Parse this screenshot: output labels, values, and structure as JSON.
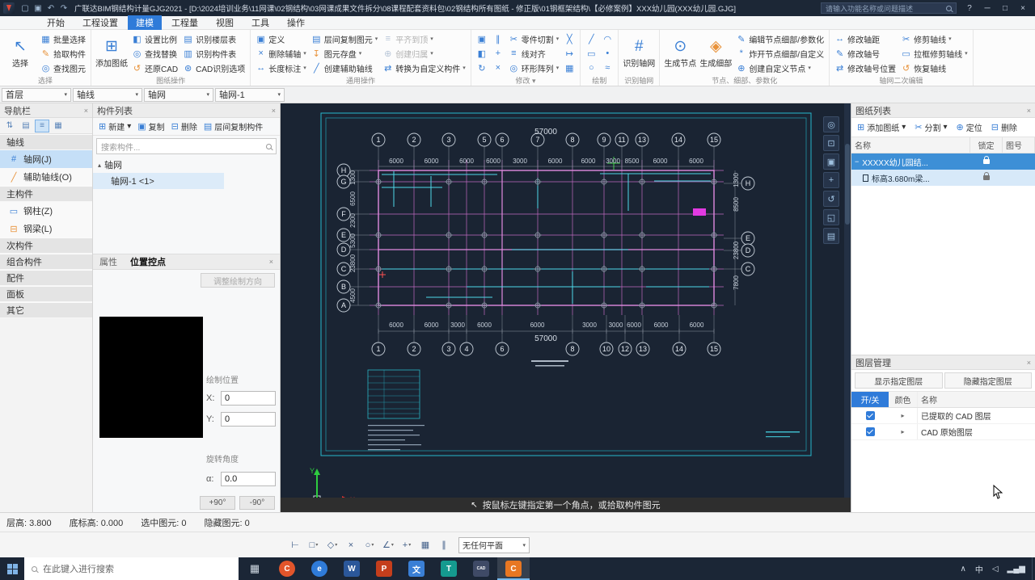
{
  "titlebar": {
    "title": "广联达BIM钢结构计量GJG2021 - [D:\\2024培训业务\\11网课\\02钢结构\\03网课成果文件拆分\\08课程配套资料包\\02钢结构所有图纸 - 修正版\\01钢框架结构\\【必修案例】XXX幼儿园(XXX幼儿园.GJG]",
    "search_placeholder": "请输入功能名称或问题描述",
    "quick_icons": [
      {
        "n": "new-file-icon",
        "g": "▢"
      },
      {
        "n": "save-icon",
        "g": "▣"
      },
      {
        "n": "undo-icon",
        "g": "↶"
      },
      {
        "n": "redo-icon",
        "g": "↷"
      }
    ]
  },
  "menubar": {
    "items": [
      {
        "label": "开始"
      },
      {
        "label": "工程设置"
      },
      {
        "label": "建模",
        "active": true
      },
      {
        "label": "工程量"
      },
      {
        "label": "视图"
      },
      {
        "label": "工具"
      },
      {
        "label": "操作"
      }
    ]
  },
  "ribbon": {
    "groups": [
      {
        "n": "select",
        "label": "选择",
        "bigs": [
          {
            "n": "select-tool",
            "g": "↖",
            "label": "选择"
          }
        ],
        "cols": [
          [
            {
              "n": "batch-select",
              "g": "▦",
              "label": "批量选择"
            },
            {
              "n": "pick-component",
              "g": "✎",
              "label": "拾取构件",
              "c": "o"
            },
            {
              "n": "find-element",
              "g": "◎",
              "label": "查找图元"
            }
          ]
        ]
      },
      {
        "n": "drawing-ops",
        "label": "图纸操作",
        "bigs": [
          {
            "n": "add-drawing",
            "g": "⊞",
            "label": "添加图纸"
          }
        ],
        "cols": [
          [
            {
              "n": "set-scale",
              "g": "◧",
              "label": "设置比例"
            },
            {
              "n": "find-replace",
              "g": "◎",
              "label": "查找替换"
            },
            {
              "n": "restore-cad",
              "g": "↺",
              "label": "还原CAD",
              "c": "o"
            }
          ],
          [
            {
              "n": "identify-floor-table",
              "g": "▤",
              "label": "识别楼层表"
            },
            {
              "n": "identify-component-table",
              "g": "▥",
              "label": "识别构件表"
            },
            {
              "n": "cad-identify-options",
              "g": "⊛",
              "label": "CAD识别选项"
            }
          ]
        ]
      },
      {
        "n": "general-ops",
        "label": "通用操作",
        "cols": [
          [
            {
              "n": "define",
              "g": "▣",
              "label": "定义"
            },
            {
              "n": "delete-aux-axis",
              "g": "×",
              "label": "删除辅轴",
              "arrow": true
            },
            {
              "n": "length-annotation",
              "g": "↔",
              "label": "长度标注",
              "arrow": true
            }
          ],
          [
            {
              "n": "copy-between-floors",
              "g": "▤",
              "label": "层间复制图元",
              "arrow": true
            },
            {
              "n": "save-element",
              "g": "↧",
              "label": "图元存盘",
              "arrow": true,
              "c": "o"
            },
            {
              "n": "create-aux-axis",
              "g": "╱",
              "label": "创建辅助轴线"
            }
          ],
          [
            {
              "n": "align-to-top",
              "g": "≡",
              "label": "平齐到顶",
              "arrow": true,
              "disabled": true
            },
            {
              "n": "create-attribution",
              "g": "⊕",
              "label": "创建归属",
              "arrow": true,
              "disabled": true
            },
            {
              "n": "convert-to-custom",
              "g": "⇄",
              "label": "转换为自定义构件",
              "arrow": true
            }
          ]
        ]
      },
      {
        "n": "modify",
        "label": "修改",
        "labelArrow": true,
        "cols": [
          [
            {
              "n": "copy-icon",
              "g": "▣"
            },
            {
              "n": "mirror-icon",
              "g": "◧"
            },
            {
              "n": "rotate-icon",
              "g": "↻"
            }
          ],
          [
            {
              "n": "offset-icon",
              "g": "∥"
            },
            {
              "n": "move-icon",
              "g": "+"
            },
            {
              "n": "delete-icon",
              "g": "×"
            }
          ],
          [
            {
              "n": "part-cut",
              "g": "✂",
              "label": "零件切割",
              "arrow": true
            },
            {
              "n": "line-align",
              "g": "≡",
              "label": "线对齐"
            },
            {
              "n": "circular-array",
              "g": "◎",
              "label": "环形阵列",
              "arrow": true
            }
          ],
          [
            {
              "n": "trim-icon",
              "g": "╳"
            },
            {
              "n": "extend-icon",
              "g": "↦"
            },
            {
              "n": "array-icon",
              "g": "▦"
            }
          ]
        ]
      },
      {
        "n": "draw",
        "label": "绘制",
        "cols": [
          [
            {
              "n": "line-draw-icon",
              "g": "╱"
            },
            {
              "n": "rect-draw-icon",
              "g": "▭"
            },
            {
              "n": "circle-draw-icon",
              "g": "○"
            }
          ],
          [
            {
              "n": "arc-draw-icon",
              "g": "◠"
            },
            {
              "n": "point-draw-icon",
              "g": "•"
            },
            {
              "n": "curve-draw-icon",
              "g": "≈"
            }
          ]
        ]
      },
      {
        "n": "identify-grid",
        "label": "识别轴网",
        "bigs": [
          {
            "n": "identify-grid",
            "g": "#",
            "label": "识别轴网"
          }
        ]
      },
      {
        "n": "node-detail-param",
        "label": "节点、细部、参数化",
        "bigs": [
          {
            "n": "generate-node",
            "g": "⊙",
            "label": "生成节点"
          },
          {
            "n": "generate-detail",
            "g": "◈",
            "label": "生成细部",
            "c": "o"
          }
        ],
        "cols": [
          [
            {
              "n": "edit-node-detail",
              "g": "✎",
              "label": "编辑节点细部/参数化"
            },
            {
              "n": "explode-node-detail",
              "g": "*",
              "label": "炸开节点细部/自定义"
            },
            {
              "n": "create-custom-node",
              "g": "⊕",
              "label": "创建自定义节点",
              "arrow": true
            }
          ]
        ]
      },
      {
        "n": "grid-edit",
        "label": "轴网二次编辑",
        "cols": [
          [
            {
              "n": "modify-axis-spacing",
              "g": "↔",
              "label": "修改轴距"
            },
            {
              "n": "modify-axis-number",
              "g": "✎",
              "label": "修改轴号"
            },
            {
              "n": "modify-axis-number-pos",
              "g": "⇄",
              "label": "修改轴号位置"
            }
          ],
          [
            {
              "n": "trim-axis",
              "g": "✂",
              "label": "修剪轴线",
              "arrow": true
            },
            {
              "n": "box-trim-axis",
              "g": "▭",
              "label": "拉框修剪轴线",
              "arrow": true
            },
            {
              "n": "restore-axis",
              "g": "↺",
              "label": "恢复轴线",
              "c": "o"
            }
          ]
        ]
      }
    ]
  },
  "context_toolbar": {
    "dropdowns": [
      {
        "n": "floor-select",
        "value": "首层"
      },
      {
        "n": "element-category-select",
        "value": "轴线"
      },
      {
        "n": "component-type-select",
        "value": "轴网"
      },
      {
        "n": "component-select",
        "value": "轴网-1"
      }
    ]
  },
  "nav": {
    "title": "导航栏",
    "tools": [
      {
        "n": "nav-collapse-icon",
        "g": "⇅"
      },
      {
        "n": "nav-grid-view-icon",
        "g": "▤"
      },
      {
        "n": "nav-list-view-icon",
        "g": "≡",
        "active": true
      },
      {
        "n": "nav-tile-view-icon",
        "g": "▦"
      }
    ],
    "items": [
      {
        "type": "header",
        "label": "轴线"
      },
      {
        "type": "item",
        "label": "轴网(J)",
        "g": "#",
        "selected": true
      },
      {
        "type": "item",
        "label": "辅助轴线(O)",
        "g": "╱",
        "c": "o"
      },
      {
        "type": "header",
        "label": "主构件"
      },
      {
        "type": "item",
        "label": "钢柱(Z)",
        "g": "▭"
      },
      {
        "type": "item",
        "label": "钢梁(L)",
        "g": "⊟",
        "c": "o"
      },
      {
        "type": "header",
        "label": "次构件"
      },
      {
        "type": "header",
        "label": "组合构件"
      },
      {
        "type": "header",
        "label": "配件"
      },
      {
        "type": "header",
        "label": "面板"
      },
      {
        "type": "header",
        "label": "其它"
      }
    ]
  },
  "component_panel": {
    "title": "构件列表",
    "toolbar": [
      {
        "n": "new-component",
        "g": "⊞",
        "label": "新建",
        "arrow": true
      },
      {
        "n": "copy-component",
        "g": "▣",
        "label": "复制"
      },
      {
        "n": "delete-component",
        "g": "⊟",
        "label": "删除"
      },
      {
        "n": "copy-between-floors-component",
        "g": "▤",
        "label": "层间复制构件"
      }
    ],
    "search_placeholder": "搜索构件...",
    "tree": {
      "group": "轴网",
      "items": [
        {
          "label": "轴网-1 <1>"
        }
      ]
    },
    "tabs": [
      {
        "label": "属性"
      },
      {
        "label": "位置控点",
        "active": true
      }
    ],
    "adjust_button": "调整绘制方向",
    "fields": {
      "position_label": "绘制位置",
      "x_label": "X:",
      "x_value": "0",
      "y_label": "Y:",
      "y_value": "0",
      "rotation_label": "旋转角度",
      "angle_label": "α:",
      "angle_value": "0.0",
      "plus_btn": "+90°",
      "minus_btn": "-90°"
    }
  },
  "viewport": {
    "message": "按鼠标左键指定第一个角点，或拾取构件图元",
    "view_tools": [
      {
        "n": "orbit-icon",
        "g": "◎"
      },
      {
        "n": "zoom-extents-icon",
        "g": "⊡"
      },
      {
        "n": "zoom-window-icon",
        "g": "▣"
      },
      {
        "n": "pan-icon",
        "g": "+"
      },
      {
        "n": "previous-view-icon",
        "g": "↺"
      },
      {
        "n": "fullscreen-icon",
        "g": "◱"
      },
      {
        "n": "layers-view-icon",
        "g": "▤"
      }
    ],
    "drawing": {
      "top_axis_numbers": [
        "1",
        "2",
        "3",
        "5",
        "6",
        "7",
        "8",
        "9",
        "11",
        "13",
        "14",
        "15"
      ],
      "bottom_axis_numbers": [
        "1",
        "2",
        "3",
        "4",
        "6",
        "8",
        "10",
        "12",
        "13",
        "14",
        "15"
      ],
      "left_axis_letters": [
        "H",
        "G",
        "F",
        "E",
        "D",
        "C",
        "B",
        "A"
      ],
      "right_axis_letters": [
        "H",
        "E",
        "D",
        "C"
      ],
      "overall_dim": "57000",
      "top_dims": [
        "6000",
        "6000",
        "6000",
        "6000",
        "3000",
        "6000",
        "6000",
        "3000",
        "8500",
        "6000",
        "6000"
      ],
      "bottom_dims": [
        "6000",
        "6000",
        "3000",
        "6000",
        "6000",
        "3000",
        "3000",
        "6000",
        "6000",
        "6000"
      ],
      "left_dims": [
        "1300",
        "6500",
        "2300",
        "5300",
        "23800",
        "4500"
      ],
      "right_dims": [
        "1300",
        "8500",
        "23800",
        "7800"
      ],
      "axis_labels": {
        "x": "X",
        "y": "Y"
      }
    }
  },
  "sheet_list": {
    "title": "图纸列表",
    "toolbar": [
      {
        "n": "add-sheet",
        "g": "⊞",
        "label": "添加图纸",
        "arrow": true
      },
      {
        "n": "split-sheet",
        "g": "✂",
        "label": "分割",
        "arrow": true
      },
      {
        "n": "locate-sheet",
        "g": "⊕",
        "label": "定位"
      },
      {
        "n": "delete-sheet",
        "g": "⊟",
        "label": "删除"
      }
    ],
    "columns": [
      "名称",
      "锁定",
      "图号"
    ],
    "rows": [
      {
        "name": "XXXXX幼儿园结...",
        "locked": true,
        "selected": true,
        "expandable": true
      },
      {
        "name": "标高3.680m梁...",
        "locked": true,
        "child": true
      }
    ]
  },
  "layer_manager": {
    "title": "图层管理",
    "buttons": [
      "显示指定图层",
      "隐藏指定图层"
    ],
    "columns": [
      "开/关",
      "颜色",
      "名称"
    ],
    "rows": [
      {
        "name": "已提取的 CAD 图层",
        "checked": true
      },
      {
        "name": "CAD 原始图层",
        "checked": true
      }
    ]
  },
  "status_bar": {
    "items": [
      "层高: 3.800",
      "底标高: 0.000",
      "选中图元: 0",
      "隐藏图元: 0"
    ]
  },
  "draw_toolbar": {
    "buttons": [
      {
        "n": "ortho-mode-icon",
        "g": "⊢"
      },
      {
        "n": "rect-mode-icon",
        "g": "□",
        "arrow": true
      },
      {
        "n": "polygon-mode-icon",
        "g": "◇",
        "arrow": true
      },
      {
        "n": "cancel-icon",
        "g": "×"
      },
      {
        "n": "circle-mode-icon",
        "g": "○",
        "arrow": true
      },
      {
        "n": "angle-snap-icon",
        "g": "∠",
        "arrow": true
      },
      {
        "n": "snap-settings-icon",
        "g": "+",
        "arrow": true
      },
      {
        "n": "grid-toggle-icon",
        "g": "▦"
      },
      {
        "n": "axis-toggle-icon",
        "g": "∥"
      }
    ],
    "plane_select": "无任何平面"
  },
  "taskbar": {
    "search_placeholder": "在此键入进行搜索",
    "apps": [
      {
        "n": "task-view-button",
        "type": "glyph",
        "g": "▦"
      },
      {
        "n": "app-icon-orange-circle",
        "type": "badge",
        "g": "C",
        "bg": "#e2552b",
        "shape": "circle"
      },
      {
        "n": "app-icon-blue-circle",
        "type": "badge",
        "g": "e",
        "bg": "#2f7bd9",
        "shape": "circle"
      },
      {
        "n": "word-icon",
        "type": "badge",
        "g": "W",
        "bg": "#2b579a"
      },
      {
        "n": "powerpoint-icon",
        "type": "badge",
        "g": "P",
        "bg": "#c43e1c"
      },
      {
        "n": "wps-docs-icon",
        "type": "badge",
        "g": "文",
        "bg": "#3a7fd5"
      },
      {
        "n": "app-icon-teal",
        "type": "badge",
        "g": "T",
        "bg": "#159a8f"
      },
      {
        "n": "cad-app-icon",
        "type": "badge",
        "g": "CAD",
        "bg": "#3f4a66",
        "small": true
      },
      {
        "n": "gjg-app-icon",
        "type": "badge",
        "g": "C",
        "bg": "#e87722",
        "active": true
      }
    ],
    "tray": [
      {
        "n": "hidden-icons-chevron",
        "g": "∧"
      },
      {
        "n": "ime-indicator",
        "g": "中"
      },
      {
        "n": "volume-icon",
        "g": "◁"
      },
      {
        "n": "network-icon",
        "g": "▂▄▆"
      }
    ]
  }
}
